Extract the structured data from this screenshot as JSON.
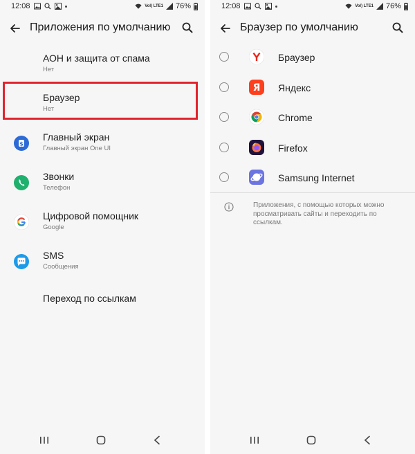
{
  "status_bar": {
    "time": "12:08",
    "battery": "76%",
    "network": "Vol) LTE1"
  },
  "left_screen": {
    "title": "Приложения по умолчанию",
    "items": [
      {
        "title": "АОН и защита от спама",
        "subtitle": "Нет",
        "icon": "none"
      },
      {
        "title": "Браузер",
        "subtitle": "Нет",
        "icon": "none",
        "highlighted": true
      },
      {
        "title": "Главный экран",
        "subtitle": "Главный экран One UI",
        "icon": "samsung-home-icon"
      },
      {
        "title": "Звонки",
        "subtitle": "Телефон",
        "icon": "phone-icon"
      },
      {
        "title": "Цифровой помощник",
        "subtitle": "Google",
        "icon": "google-icon"
      },
      {
        "title": "SMS",
        "subtitle": "Сообщения",
        "icon": "messages-icon"
      },
      {
        "title": "Переход по ссылкам",
        "subtitle": "",
        "icon": "none"
      }
    ]
  },
  "right_screen": {
    "title": "Браузер по умолчанию",
    "options": [
      {
        "label": "Браузер",
        "icon": "yandex-browser-icon",
        "selected": false
      },
      {
        "label": "Яндекс",
        "icon": "yandex-icon",
        "selected": false
      },
      {
        "label": "Chrome",
        "icon": "chrome-icon",
        "selected": false
      },
      {
        "label": "Firefox",
        "icon": "firefox-icon",
        "selected": false
      },
      {
        "label": "Samsung Internet",
        "icon": "samsung-internet-icon",
        "selected": false
      }
    ],
    "info_text": "Приложения, с помощью которых можно просматривать сайты и переходить по ссылкам."
  },
  "colors": {
    "highlight": "#e2232d",
    "screen_bg": "#f6f6f6",
    "text": "#202020",
    "subtext": "#7a7a7a"
  }
}
